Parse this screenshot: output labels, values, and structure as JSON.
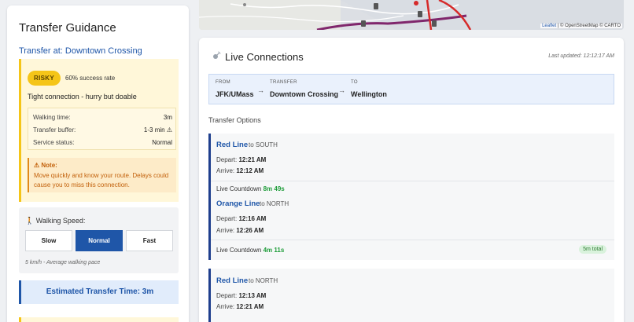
{
  "left": {
    "title": "Transfer Guidance",
    "transfer_at": "Transfer at: Downtown Crossing",
    "risk": {
      "badge": "RISKY",
      "success_rate": "60% success rate",
      "summary": "Tight connection - hurry but doable",
      "details": [
        {
          "label": "Walking time:",
          "value": "3m"
        },
        {
          "label": "Transfer buffer:",
          "value": "1-3 min ⚠"
        },
        {
          "label": "Service status:",
          "value": "Normal"
        }
      ],
      "note_title": "⚠ Note:",
      "note_text": "Move quickly and know your route. Delays could cause you to miss this connection."
    },
    "walking_speed": {
      "title": "🚶 Walking Speed:",
      "options": [
        "Slow",
        "Normal",
        "Fast"
      ],
      "selected": "Normal",
      "pace": "5 km/h - Average walking pace"
    },
    "estimated": "Estimated Transfer Time: 3m"
  },
  "map": {
    "attribution_leaflet": "Leaflet",
    "attribution_rest": " | © OpenStreetMap © CARTO"
  },
  "connections": {
    "title": "Live Connections",
    "last_updated": "Last updated: 12:12:17 AM",
    "route": {
      "from_label": "FROM",
      "from": "JFK/UMass",
      "transfer_label": "TRANSFER",
      "transfer": "Downtown Crossing",
      "to_label": "TO",
      "to": "Wellington",
      "arrow": "→"
    },
    "options_title": "Transfer Options",
    "options": [
      {
        "first": {
          "line": "Red Line",
          "dir": "to SOUTH",
          "depart_label": "Depart:",
          "depart": "12:21 AM",
          "arrive_label": "Arrive:",
          "arrive": "12:12 AM"
        },
        "countdown1_label": "Live Countdown",
        "countdown1": "8m 49s",
        "second": {
          "line": "Orange Line",
          "dir": "to NORTH",
          "depart_label": "Depart:",
          "depart": "12:16 AM",
          "arrive_label": "Arrive:",
          "arrive": "12:26 AM"
        },
        "countdown2_label": "Live Countdown",
        "countdown2": "4m 11s",
        "total": "5m total"
      },
      {
        "first": {
          "line": "Red Line",
          "dir": "to NORTH",
          "depart_label": "Depart:",
          "depart": "12:13 AM",
          "arrive_label": "Arrive:",
          "arrive": "12:21 AM"
        }
      }
    ]
  },
  "colors": {
    "accent": "#1f56a8",
    "risky": "#f5c518",
    "red_line": "#d62a2a",
    "purple_line": "#80276c",
    "countdown": "#1f9d3a"
  }
}
